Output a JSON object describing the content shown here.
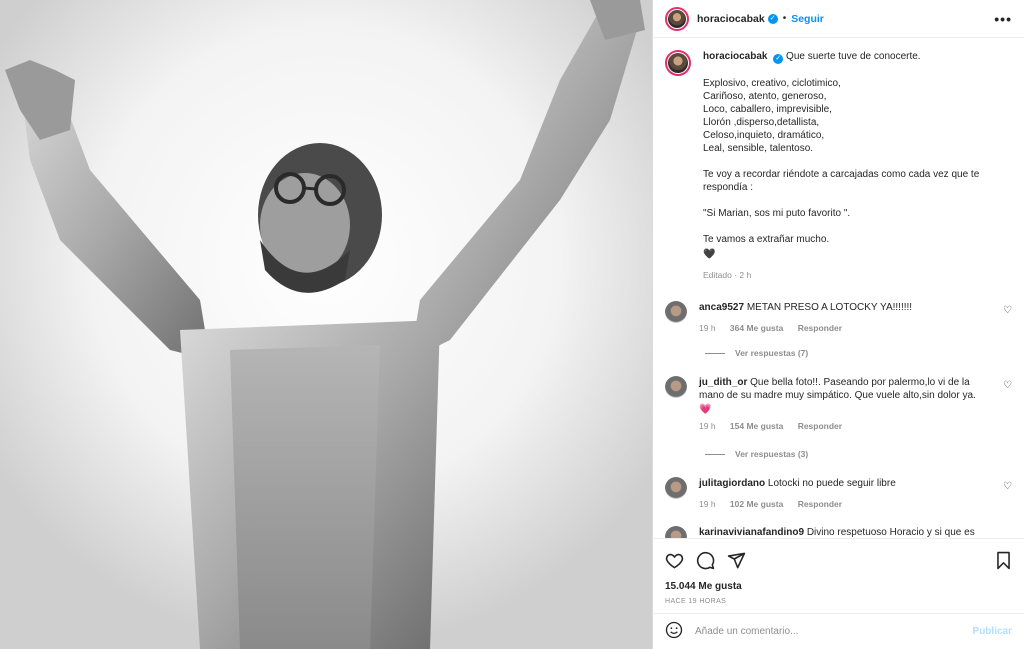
{
  "post": {
    "username": "horaciocabak",
    "follow_label": "Seguir",
    "dot": "•",
    "more_label": "•••"
  },
  "caption": {
    "username": "horaciocabak",
    "first_line": "Que suerte tuve de conocerte.",
    "lines": [
      "Explosivo, creativo, ciclotimico,",
      "Cariñoso, atento, generoso,",
      "Loco, caballero, imprevisible,",
      "Llorón ,disperso,detallista,",
      "Celoso,inquieto, dramático,",
      "Leal, sensible, talentoso."
    ],
    "para2": [
      "Te voy a recordar riéndote a carcajadas como cada vez que te",
      "respondía :"
    ],
    "quote": "\"Si Marian, sos mi puto favorito \".",
    "goodbye": "Te vamos a extrañar mucho.",
    "heart": "🖤",
    "meta": "Editado · 2 h"
  },
  "comments": [
    {
      "username": "anca9527",
      "text": "METAN PRESO A LOTOCKY YA!!!!!!!",
      "time": "19 h",
      "likes": "364 Me gusta",
      "reply": "Responder",
      "replies": "Ver respuestas (7)"
    },
    {
      "username": "ju_dith_or",
      "text": "Que bella foto!!. Paseando por palermo,lo vi de la mano de su madre muy simpático. Que vuele alto,sin dolor ya.",
      "emoji": "💗",
      "time": "19 h",
      "likes": "154 Me gusta",
      "reply": "Responder",
      "replies": "Ver respuestas (3)"
    },
    {
      "username": "julitagiordano",
      "text": "Lotocki no puede seguir libre",
      "time": "19 h",
      "likes": "102 Me gusta",
      "reply": "Responder"
    },
    {
      "username": "karinavivianafandino9",
      "text": "Divino respetuoso Horacio y si que es"
    }
  ],
  "actions": {
    "likes": "15.044 Me gusta",
    "ago": "HACE 19 HORAS"
  },
  "composer": {
    "placeholder": "Añade un comentario...",
    "publish": "Publicar"
  }
}
